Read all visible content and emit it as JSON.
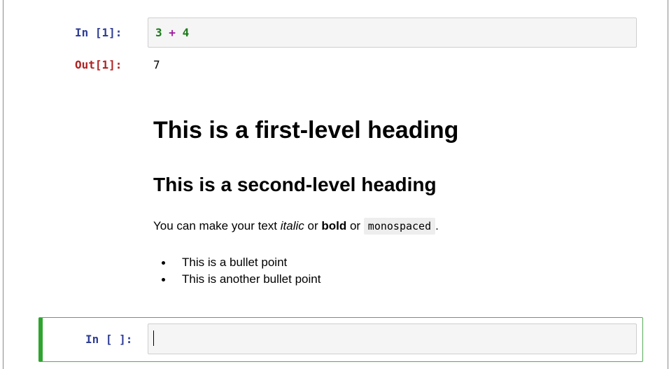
{
  "cell1": {
    "in_prompt": "In [1]:",
    "code": {
      "left": "3",
      "operator": "+",
      "right": "4"
    },
    "out_prompt": "Out[1]:",
    "output": "7"
  },
  "markdown": {
    "h1": "This is a first-level heading",
    "h2": "This is a second-level heading",
    "paragraph": {
      "part1": "You can make your text ",
      "italic": "italic",
      "part2": " or ",
      "bold": "bold",
      "part3": " or ",
      "mono": "monospaced",
      "part4": "."
    },
    "bullets": [
      "This is a bullet point",
      "This is another bullet point"
    ]
  },
  "cell2": {
    "in_prompt": "In [ ]:",
    "code": ""
  },
  "colors": {
    "in_prompt": "#2e3d95",
    "out_prompt": "#b22222",
    "active_border": "#2ea42e",
    "number": "#1a7a1a",
    "operator": "#a020a0"
  }
}
